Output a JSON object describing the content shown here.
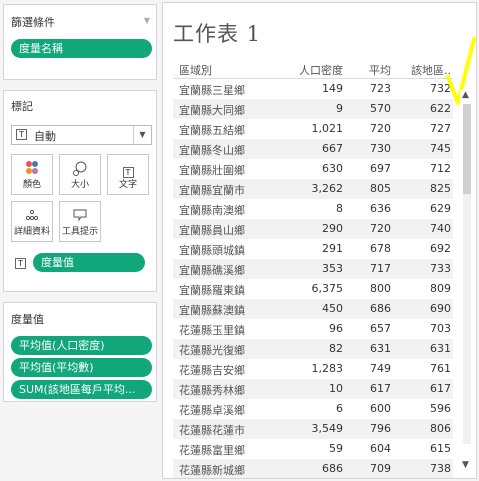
{
  "filters": {
    "title": "篩選條件",
    "pill": "度量名稱"
  },
  "marks": {
    "title": "標記",
    "type": "自動",
    "buttons": [
      {
        "label": "顏色",
        "icon": "color-dots-icon"
      },
      {
        "label": "大小",
        "icon": "size-icon"
      },
      {
        "label": "文字",
        "icon": "text-icon"
      },
      {
        "label": "詳細資料",
        "icon": "detail-icon"
      },
      {
        "label": "工具提示",
        "icon": "tooltip-icon"
      }
    ],
    "text_pill": "度量值"
  },
  "measures": {
    "title": "度量值",
    "pills": [
      "平均值(人口密度)",
      "平均值(平均數)",
      "SUM(該地區每戶平均..."
    ]
  },
  "sheet": {
    "title": "工作表 1",
    "headers": [
      "區域別",
      "人口密度",
      "平均",
      "該地區.."
    ],
    "rows": [
      [
        "宜蘭縣三星鄉",
        "149",
        "723",
        "732"
      ],
      [
        "宜蘭縣大同鄉",
        "9",
        "570",
        "622"
      ],
      [
        "宜蘭縣五結鄉",
        "1,021",
        "720",
        "727"
      ],
      [
        "宜蘭縣冬山鄉",
        "667",
        "730",
        "745"
      ],
      [
        "宜蘭縣壯圍鄉",
        "630",
        "697",
        "712"
      ],
      [
        "宜蘭縣宜蘭市",
        "3,262",
        "805",
        "825"
      ],
      [
        "宜蘭縣南澳鄉",
        "8",
        "636",
        "629"
      ],
      [
        "宜蘭縣員山鄉",
        "290",
        "720",
        "740"
      ],
      [
        "宜蘭縣頭城鎮",
        "291",
        "678",
        "692"
      ],
      [
        "宜蘭縣礁溪鄉",
        "353",
        "717",
        "733"
      ],
      [
        "宜蘭縣羅東鎮",
        "6,375",
        "800",
        "809"
      ],
      [
        "宜蘭縣蘇澳鎮",
        "450",
        "686",
        "690"
      ],
      [
        "花蓮縣玉里鎮",
        "96",
        "657",
        "703"
      ],
      [
        "花蓮縣光復鄉",
        "82",
        "631",
        "631"
      ],
      [
        "花蓮縣吉安鄉",
        "1,283",
        "749",
        "761"
      ],
      [
        "花蓮縣秀林鄉",
        "10",
        "617",
        "617"
      ],
      [
        "花蓮縣卓溪鄉",
        "6",
        "600",
        "596"
      ],
      [
        "花蓮縣花蓮市",
        "3,549",
        "796",
        "806"
      ],
      [
        "花蓮縣富里鄉",
        "59",
        "604",
        "615"
      ],
      [
        "花蓮縣新城鄉",
        "686",
        "709",
        "738"
      ]
    ]
  },
  "annotation_color": "#ffff00"
}
